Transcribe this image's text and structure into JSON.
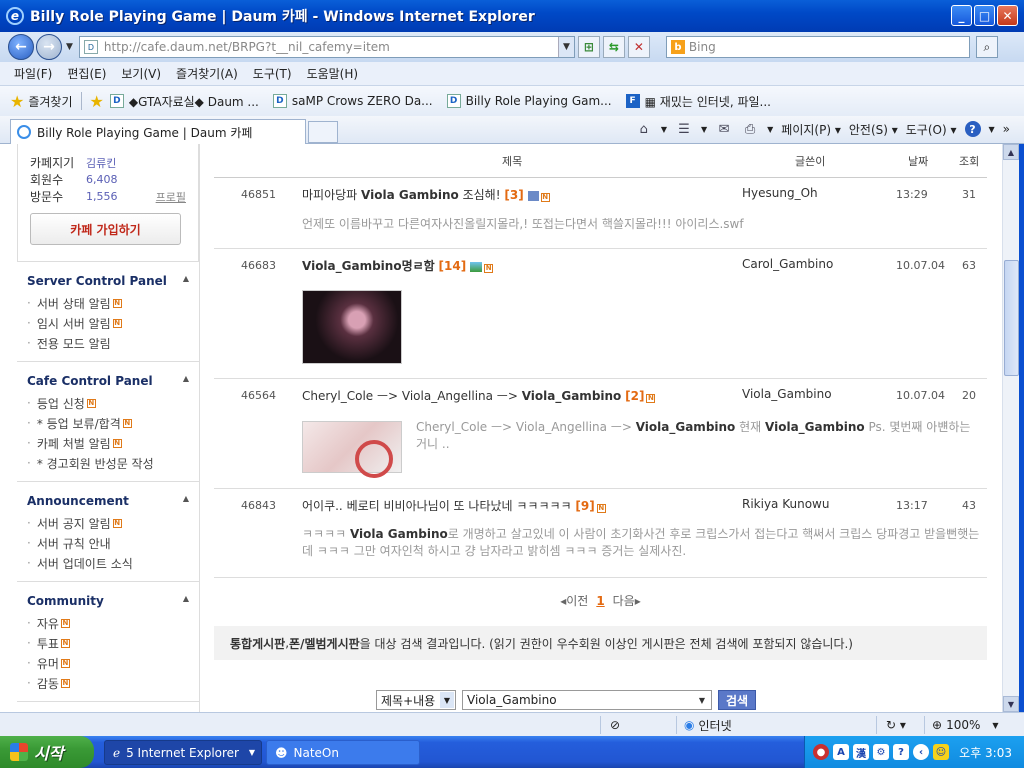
{
  "window": {
    "title": "Billy Role Playing Game | Daum 카페 - Windows Internet Explorer"
  },
  "address": {
    "url": "http://cafe.daum.net/BRPG?t__nil_cafemy=item",
    "search_engine": "Bing"
  },
  "menu": [
    "파일(F)",
    "편집(E)",
    "보기(V)",
    "즐겨찾기(A)",
    "도구(T)",
    "도움말(H)"
  ],
  "favorites": {
    "label": "즐겨찾기",
    "items": [
      "◆GTA자료실◆  Daum ...",
      "saMP Crows ZERO  Da...",
      "Billy Role Playing Gam...",
      "▦ 재밌는 인터넷, 파일..."
    ]
  },
  "tab": {
    "title": "Billy Role Playing Game | Daum 카페"
  },
  "commands": [
    "페이지(P)",
    "안전(S)",
    "도구(O)"
  ],
  "profile": {
    "rows": [
      {
        "key": "카페지기",
        "value": "김류킨"
      },
      {
        "key": "회원수",
        "value": "6,408"
      },
      {
        "key": "방문수",
        "value": "1,556",
        "link": "프로필"
      }
    ],
    "join_label": "카페 가입하기"
  },
  "sections": [
    {
      "title": "Server Control Panel",
      "items": [
        {
          "label": "서버 상태 알림",
          "new": true
        },
        {
          "label": "임시 서버 알림",
          "new": true
        },
        {
          "label": "전용 모드 알림",
          "new": false
        }
      ]
    },
    {
      "title": "Cafe Control Panel",
      "items": [
        {
          "label": "등업 신청",
          "new": true
        },
        {
          "label": "* 등업 보류/합격",
          "new": true
        },
        {
          "label": "카페 처벌 알림",
          "new": true
        },
        {
          "label": "* 경고회원 반성문 작성",
          "new": false
        }
      ]
    },
    {
      "title": "Announcement",
      "items": [
        {
          "label": "서버 공지 알림",
          "new": true
        },
        {
          "label": "서버 규칙 안내",
          "new": false
        },
        {
          "label": "서버 업데이트 소식",
          "new": false
        }
      ]
    },
    {
      "title": "Community",
      "items": [
        {
          "label": "자유",
          "new": true
        },
        {
          "label": "투표",
          "new": true
        },
        {
          "label": "유머",
          "new": true
        },
        {
          "label": "감동",
          "new": true
        }
      ]
    }
  ],
  "list": {
    "headers": {
      "subject": "제목",
      "author": "글쓴이",
      "date": "날짜",
      "views": "조회"
    },
    "posts": [
      {
        "num": "46851",
        "subject_pre": "마피아당파 ",
        "subject_bold": "Viola Gambino",
        "subject_post": " 조심해!",
        "count": "[3]",
        "author": "Hyesung_Oh",
        "date": "13:29",
        "views": "31",
        "body": "언제또 이름바꾸고 다른여자사진올릴지몰라,! 또접는다면서 핵쓸지몰라!!! 아이리스.swf"
      },
      {
        "num": "46683",
        "subject_pre": "",
        "subject_bold": "Viola_Gambino",
        "subject_post": "명ㄹ함",
        "count": "[14]",
        "author": "Carol_Gambino",
        "date": "10.07.04",
        "views": "63"
      },
      {
        "num": "46564",
        "subject_pre": "Cheryl_Cole ㅡ>  Viola_Angellina ㅡ>  ",
        "subject_bold": "Viola_Gambino",
        "subject_post": "",
        "count": "[2]",
        "author": "Viola_Gambino",
        "date": "10.07.04",
        "views": "20",
        "body_pre": "Cheryl_Cole ㅡ> Viola_Angellina ㅡ> ",
        "body_bold1": "Viola_Gambino",
        "body_mid": " 현재 ",
        "body_bold2": "Viola_Gambino",
        "body_post": " Ps. 몇번째 아뱬하는거니 .."
      },
      {
        "num": "46843",
        "subject_pre": "어이쿠.. 베로티 비비아나님이 또 나타났네 ㅋㅋㅋㅋㅋ",
        "subject_bold": "",
        "subject_post": "",
        "count": "[9]",
        "author": "Rikiya Kunowu",
        "date": "13:17",
        "views": "43",
        "body_pre": "ㅋㅋㅋㅋ ",
        "body_bold1": "Viola Gambino",
        "body_post": "로 개명하고 살고있네 이 사람이 초기화사건 후로 크립스가서 접는다고 핵써서 크립스 당파경고 받을뻔햇는데 ㅋㅋㅋ 그만 여자인척 하시고 걍 남자라고 밝히셈 ㅋㅋㅋ 증거는 실제사진."
      }
    ]
  },
  "pager": {
    "prev": "◂이전",
    "current": "1",
    "next": "다음▸"
  },
  "notice": {
    "bold1": "통합게시판",
    "mid1": ", ",
    "bold2": "폰/멜범게시판",
    "rest": "을 대상 검색 결과입니다. (읽기 권한이 우수회원 이상인 게시판은 전체 검색에 포함되지 않습니다.)"
  },
  "search": {
    "scope": "제목+내용",
    "query": "Viola_Gambino",
    "button": "검색"
  },
  "status": {
    "zone": "인터넷",
    "zoom": "100%"
  },
  "taskbar": {
    "start": "시작",
    "items": [
      "5 Internet Explorer",
      "NateOn"
    ],
    "clock": "오후 3:03"
  }
}
